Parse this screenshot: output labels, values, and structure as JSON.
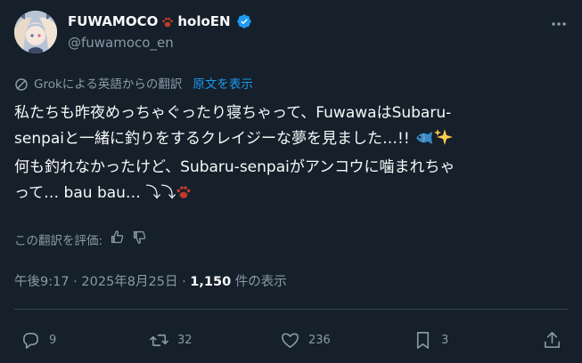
{
  "author": {
    "display_name": "FUWAMOCO",
    "name_suffix": "holoEN",
    "handle": "@fuwamoco_en",
    "verified": true
  },
  "translation": {
    "notice": "Grokによる英語からの翻訳",
    "show_original": "原文を表示"
  },
  "tweet": {
    "line1": "私たちも昨夜めっちゃぐったり寝ちゃって、FuwawaはSubaru-",
    "line2": "senpaiと一緒に釣りをするクレイジーな夢を見ました…!!",
    "line3": "何も釣れなかったけど、Subaru-senpaiがアンコウに噛まれちゃ",
    "line4": "って… bau bau… ⤵⤵"
  },
  "rate": {
    "label": "この翻訳を評価:"
  },
  "meta": {
    "time": "午後9:17",
    "sep1": "·",
    "date": "2025年8月25日",
    "sep2": "·",
    "views": "1,150",
    "views_label": "件の表示"
  },
  "actions": {
    "replies": "9",
    "reposts": "32",
    "likes": "236",
    "bookmarks": "3"
  },
  "colors": {
    "background": "#15202b",
    "text_primary": "#f7f9f9",
    "text_secondary": "#8b98a5",
    "link": "#1d9bf0",
    "divider": "#38444d"
  },
  "icons": [
    "avatar",
    "paw-icon",
    "verified-icon",
    "more-icon",
    "grok-icon",
    "fish-emoji",
    "sparkles-emoji",
    "thumbs-up-icon",
    "thumbs-down-icon",
    "reply-icon",
    "repost-icon",
    "like-icon",
    "bookmark-icon",
    "share-icon"
  ]
}
